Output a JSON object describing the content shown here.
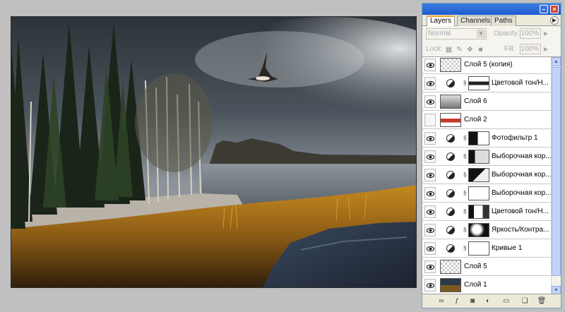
{
  "panel": {
    "tabs": [
      {
        "label": "Layers",
        "active": true
      },
      {
        "label": "Channels",
        "active": false
      },
      {
        "label": "Paths",
        "active": false
      }
    ],
    "blend_mode": "Normal",
    "opacity_label": "Opacity:",
    "opacity_value": "100%",
    "lock_label": "Lock:",
    "fill_label": "Fill:",
    "fill_value": "100%",
    "layers": [
      {
        "name": "Слой 5 (копия)",
        "visible": true,
        "kind": "pixel-transparent"
      },
      {
        "name": "Цветовой тон/Н...",
        "visible": true,
        "kind": "adjustment",
        "mask": "dark-strip"
      },
      {
        "name": "Слой 6",
        "visible": true,
        "kind": "pixel-gray"
      },
      {
        "name": "Слой 2",
        "visible": false,
        "kind": "pixel-red"
      },
      {
        "name": "Фотофильтр 1",
        "visible": true,
        "kind": "adjustment",
        "mask": "black-white"
      },
      {
        "name": "Выборочная кор...",
        "visible": true,
        "kind": "adjustment",
        "mask": "black-light"
      },
      {
        "name": "Выборочная кор...",
        "visible": true,
        "kind": "adjustment",
        "mask": "black-white2"
      },
      {
        "name": "Выборочная кор...",
        "visible": true,
        "kind": "adjustment",
        "mask": "white"
      },
      {
        "name": "Цветовой тон/Н...",
        "visible": true,
        "kind": "adjustment",
        "mask": "black-white3"
      },
      {
        "name": "Яркость/Контра...",
        "visible": true,
        "kind": "adjustment",
        "mask": "black-clouds"
      },
      {
        "name": "Кривые 1",
        "visible": true,
        "kind": "adjustment",
        "mask": "white"
      },
      {
        "name": "Слой 5",
        "visible": true,
        "kind": "pixel-transparent"
      },
      {
        "name": "Слой 1",
        "visible": true,
        "kind": "pixel-photo"
      }
    ],
    "bottom_icons": [
      "link-icon",
      "fx-icon",
      "mask-icon",
      "adjustment-icon",
      "folder-icon",
      "new-layer-icon",
      "trash-icon"
    ]
  },
  "colors": {
    "titlebar": "#1c5ad0",
    "panel_bg": "#ece9d8",
    "app_bg": "#c0c0c0",
    "tab_highlight": "#f0a030"
  }
}
